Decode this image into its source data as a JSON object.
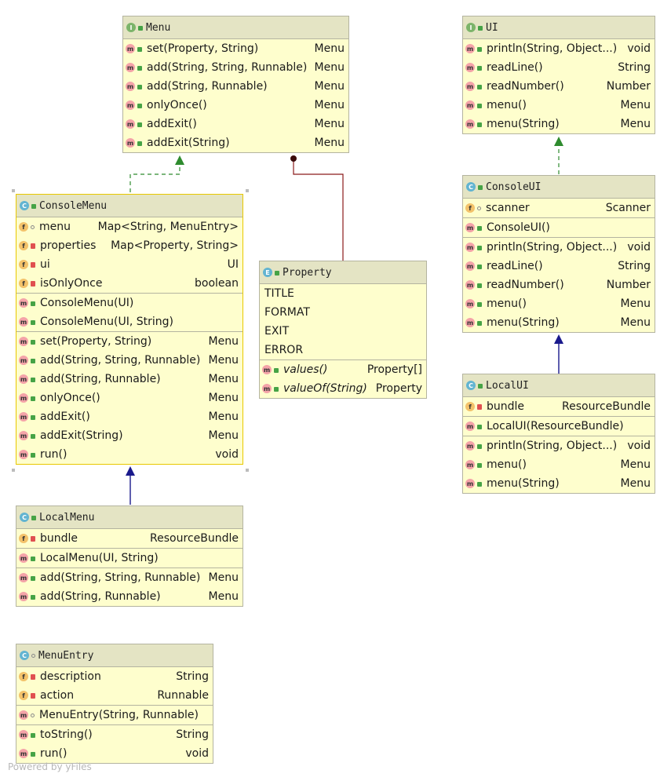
{
  "footer": "Powered by yFiles",
  "classes": {
    "menu": {
      "name": "Menu",
      "kind": "I",
      "sections": [
        [
          {
            "k": "m",
            "v": "pub",
            "n": "set(Property, String)",
            "t": "Menu"
          },
          {
            "k": "m",
            "v": "pub",
            "n": "add(String, String, Runnable)",
            "t": "Menu"
          },
          {
            "k": "m",
            "v": "pub",
            "n": "add(String, Runnable)",
            "t": "Menu"
          },
          {
            "k": "m",
            "v": "pub",
            "n": "onlyOnce()",
            "t": "Menu"
          },
          {
            "k": "m",
            "v": "pub",
            "n": "addExit()",
            "t": "Menu"
          },
          {
            "k": "m",
            "v": "pub",
            "n": "addExit(String)",
            "t": "Menu"
          }
        ]
      ]
    },
    "ui": {
      "name": "UI",
      "kind": "I",
      "sections": [
        [
          {
            "k": "m",
            "v": "pub",
            "n": "println(String, Object...)",
            "t": "void"
          },
          {
            "k": "m",
            "v": "pub",
            "n": "readLine()",
            "t": "String"
          },
          {
            "k": "m",
            "v": "pub",
            "n": "readNumber()",
            "t": "Number"
          },
          {
            "k": "m",
            "v": "pub",
            "n": "menu()",
            "t": "Menu"
          },
          {
            "k": "m",
            "v": "pub",
            "n": "menu(String)",
            "t": "Menu"
          }
        ]
      ]
    },
    "consoleMenu": {
      "name": "ConsoleMenu",
      "kind": "C",
      "sections": [
        [
          {
            "k": "f",
            "v": "pkg",
            "n": "menu",
            "t": "Map<String, MenuEntry>"
          },
          {
            "k": "f",
            "v": "priv",
            "n": "properties",
            "t": "Map<Property, String>"
          },
          {
            "k": "f",
            "v": "priv",
            "n": "ui",
            "t": "UI"
          },
          {
            "k": "f",
            "v": "priv",
            "n": "isOnlyOnce",
            "t": "boolean"
          }
        ],
        [
          {
            "k": "m",
            "v": "pub",
            "n": "ConsoleMenu(UI)",
            "t": ""
          },
          {
            "k": "m",
            "v": "pub",
            "n": "ConsoleMenu(UI, String)",
            "t": ""
          }
        ],
        [
          {
            "k": "m",
            "v": "pub",
            "n": "set(Property, String)",
            "t": "Menu"
          },
          {
            "k": "m",
            "v": "pub",
            "n": "add(String, String, Runnable)",
            "t": "Menu"
          },
          {
            "k": "m",
            "v": "pub",
            "n": "add(String, Runnable)",
            "t": "Menu"
          },
          {
            "k": "m",
            "v": "pub",
            "n": "onlyOnce()",
            "t": "Menu"
          },
          {
            "k": "m",
            "v": "pub",
            "n": "addExit()",
            "t": "Menu"
          },
          {
            "k": "m",
            "v": "pub",
            "n": "addExit(String)",
            "t": "Menu"
          },
          {
            "k": "m",
            "v": "pub",
            "n": "run()",
            "t": "void"
          }
        ]
      ]
    },
    "property": {
      "name": "Property",
      "kind": "E",
      "sections": [
        [
          {
            "k": "",
            "v": "",
            "n": "TITLE",
            "t": ""
          },
          {
            "k": "",
            "v": "",
            "n": "FORMAT",
            "t": ""
          },
          {
            "k": "",
            "v": "",
            "n": "EXIT",
            "t": ""
          },
          {
            "k": "",
            "v": "",
            "n": "ERROR",
            "t": ""
          }
        ],
        [
          {
            "k": "m",
            "v": "pub",
            "n": "values()",
            "t": "Property[]",
            "it": true
          },
          {
            "k": "m",
            "v": "pub",
            "n": "valueOf(String)",
            "t": "Property",
            "it": true
          }
        ]
      ]
    },
    "consoleUI": {
      "name": "ConsoleUI",
      "kind": "C",
      "sections": [
        [
          {
            "k": "f",
            "v": "pkg",
            "n": "scanner",
            "t": "Scanner"
          }
        ],
        [
          {
            "k": "m",
            "v": "pub",
            "n": "ConsoleUI()",
            "t": ""
          }
        ],
        [
          {
            "k": "m",
            "v": "pub",
            "n": "println(String, Object...)",
            "t": "void"
          },
          {
            "k": "m",
            "v": "pub",
            "n": "readLine()",
            "t": "String"
          },
          {
            "k": "m",
            "v": "pub",
            "n": "readNumber()",
            "t": "Number"
          },
          {
            "k": "m",
            "v": "pub",
            "n": "menu()",
            "t": "Menu"
          },
          {
            "k": "m",
            "v": "pub",
            "n": "menu(String)",
            "t": "Menu"
          }
        ]
      ]
    },
    "localUI": {
      "name": "LocalUI",
      "kind": "C",
      "sections": [
        [
          {
            "k": "f",
            "v": "priv",
            "n": "bundle",
            "t": "ResourceBundle"
          }
        ],
        [
          {
            "k": "m",
            "v": "pub",
            "n": "LocalUI(ResourceBundle)",
            "t": ""
          }
        ],
        [
          {
            "k": "m",
            "v": "pub",
            "n": "println(String, Object...)",
            "t": "void"
          },
          {
            "k": "m",
            "v": "pub",
            "n": "menu()",
            "t": "Menu"
          },
          {
            "k": "m",
            "v": "pub",
            "n": "menu(String)",
            "t": "Menu"
          }
        ]
      ]
    },
    "localMenu": {
      "name": "LocalMenu",
      "kind": "C",
      "sections": [
        [
          {
            "k": "f",
            "v": "priv",
            "n": "bundle",
            "t": "ResourceBundle"
          }
        ],
        [
          {
            "k": "m",
            "v": "pub",
            "n": "LocalMenu(UI, String)",
            "t": ""
          }
        ],
        [
          {
            "k": "m",
            "v": "pub",
            "n": "add(String, String, Runnable)",
            "t": "Menu"
          },
          {
            "k": "m",
            "v": "pub",
            "n": "add(String, Runnable)",
            "t": "Menu"
          }
        ]
      ]
    },
    "menuEntry": {
      "name": "MenuEntry",
      "kind": "C",
      "vis": "pkg",
      "sections": [
        [
          {
            "k": "f",
            "v": "priv",
            "n": "description",
            "t": "String"
          },
          {
            "k": "f",
            "v": "priv",
            "n": "action",
            "t": "Runnable"
          }
        ],
        [
          {
            "k": "m",
            "v": "pkg",
            "n": "MenuEntry(String, Runnable)",
            "t": ""
          }
        ],
        [
          {
            "k": "m",
            "v": "pub",
            "n": "toString()",
            "t": "String"
          },
          {
            "k": "m",
            "v": "pub",
            "n": "run()",
            "t": "void"
          }
        ]
      ]
    }
  },
  "colors": {
    "implements": "#2e8b2e",
    "extends": "#1a1a8c",
    "uses": "#8b1a1a"
  }
}
